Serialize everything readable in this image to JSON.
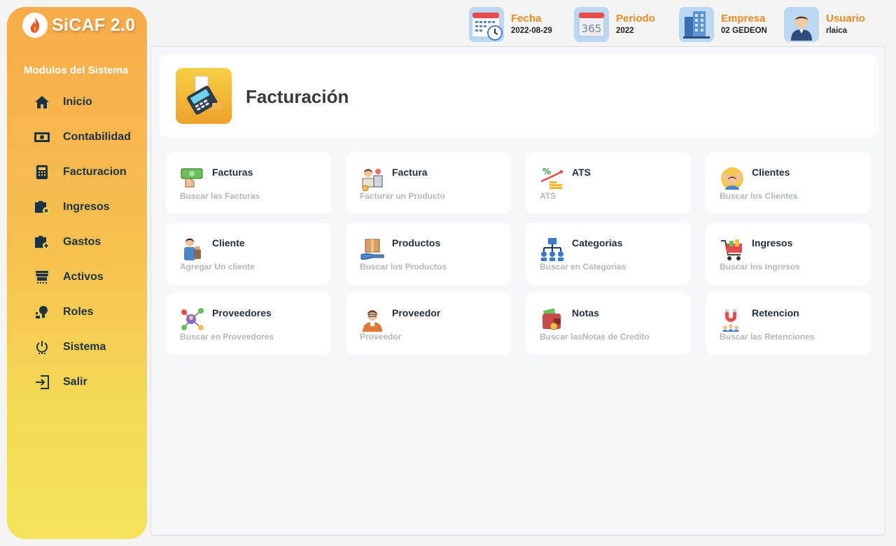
{
  "brand": {
    "title": "SiCAF 2.0"
  },
  "sidebar": {
    "section_title": "Modulos del Sistema",
    "items": [
      {
        "label": "Inicio",
        "icon": "home-icon"
      },
      {
        "label": "Contabilidad",
        "icon": "money-icon"
      },
      {
        "label": "Facturacion",
        "icon": "calculator-icon"
      },
      {
        "label": "Ingresos",
        "icon": "briefcase-x-icon"
      },
      {
        "label": "Gastos",
        "icon": "briefcase-plus-icon"
      },
      {
        "label": "Activos",
        "icon": "store-icon"
      },
      {
        "label": "Roles",
        "icon": "user-roles-icon"
      },
      {
        "label": "Sistema",
        "icon": "power-icon"
      },
      {
        "label": "Salir",
        "icon": "exit-icon"
      }
    ]
  },
  "header": {
    "fecha": {
      "label": "Fecha",
      "value": "2022-08-29",
      "icon": "calendar-clock-icon"
    },
    "periodo": {
      "label": "Periodo",
      "value": "2022",
      "icon": "calendar-365-icon"
    },
    "empresa": {
      "label": "Empresa",
      "value": "02 GEDEON",
      "icon": "building-icon"
    },
    "usuario": {
      "label": "Usuario",
      "value": "rlaica",
      "icon": "user-avatar-icon"
    }
  },
  "page": {
    "title": "Facturación",
    "icon": "payment-terminal-icon"
  },
  "cards": [
    {
      "title": "Facturas",
      "subtitle": "Buscar las Facturas",
      "icon": "cash-hand-icon"
    },
    {
      "title": "Factura",
      "subtitle": "Facturar un Producto",
      "icon": "cashier-icon"
    },
    {
      "title": "ATS",
      "subtitle": "ATS",
      "icon": "percent-growth-icon"
    },
    {
      "title": "Clientes",
      "subtitle": "Buscar los Clientes",
      "icon": "clients-group-icon"
    },
    {
      "title": "Cliente",
      "subtitle": "Agregar Un cliente",
      "icon": "customer-icon"
    },
    {
      "title": "Productos",
      "subtitle": "Buscar los Productos",
      "icon": "product-box-icon"
    },
    {
      "title": "Categorias",
      "subtitle": "Buscar en Categorias",
      "icon": "hierarchy-icon"
    },
    {
      "title": "Ingresos",
      "subtitle": "Buscar los Ingresos",
      "icon": "shopping-cart-icon"
    },
    {
      "title": "Proveedores",
      "subtitle": "Buscar en Proveedores",
      "icon": "supplier-network-icon"
    },
    {
      "title": "Proveedor",
      "subtitle": "Proveedor",
      "icon": "supplier-person-icon"
    },
    {
      "title": "Notas",
      "subtitle": "Buscar lasNotas de Credito",
      "icon": "wallet-icon"
    },
    {
      "title": "Retencion",
      "subtitle": "Buscar las Retenciones",
      "icon": "magnet-icon"
    }
  ],
  "colors": {
    "accent": "#ee8a1f",
    "nav_text": "#1d3344",
    "sidebar_top": "#f8ab4a",
    "sidebar_bottom": "#f4e35b"
  }
}
